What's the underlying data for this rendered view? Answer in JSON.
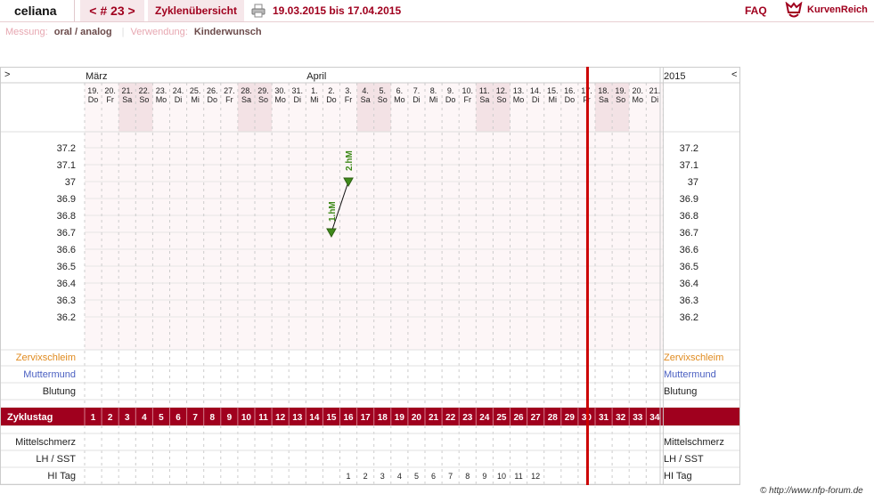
{
  "header": {
    "username": "celiana",
    "cycle_label": "< # 23 >",
    "overview_label": "Zyklenübersicht",
    "date_range": "19.03.2015 bis 17.04.2015",
    "faq_label": "FAQ",
    "brand": "KurvenReich"
  },
  "subbar": {
    "measurement_label": "Messung:",
    "measurement_value": "oral / analog",
    "usage_label": "Verwendung:",
    "usage_value": "Kinderwunsch"
  },
  "chart": {
    "nav_prev": ">",
    "nav_next": "<",
    "year": "2015",
    "months": [
      {
        "label": "März",
        "col": 0
      },
      {
        "label": "April",
        "col": 13
      }
    ],
    "days": [
      {
        "d": "19.",
        "w": "Do"
      },
      {
        "d": "20.",
        "w": "Fr"
      },
      {
        "d": "21.",
        "w": "Sa"
      },
      {
        "d": "22.",
        "w": "So"
      },
      {
        "d": "23.",
        "w": "Mo"
      },
      {
        "d": "24.",
        "w": "Di"
      },
      {
        "d": "25.",
        "w": "Mi"
      },
      {
        "d": "26.",
        "w": "Do"
      },
      {
        "d": "27.",
        "w": "Fr"
      },
      {
        "d": "28.",
        "w": "Sa"
      },
      {
        "d": "29.",
        "w": "So"
      },
      {
        "d": "30.",
        "w": "Mo"
      },
      {
        "d": "31.",
        "w": "Di"
      },
      {
        "d": "1.",
        "w": "Mi"
      },
      {
        "d": "2.",
        "w": "Do"
      },
      {
        "d": "3.",
        "w": "Fr"
      },
      {
        "d": "4.",
        "w": "Sa"
      },
      {
        "d": "5.",
        "w": "So"
      },
      {
        "d": "6.",
        "w": "Mo"
      },
      {
        "d": "7.",
        "w": "Di"
      },
      {
        "d": "8.",
        "w": "Mi"
      },
      {
        "d": "9.",
        "w": "Do"
      },
      {
        "d": "10.",
        "w": "Fr"
      },
      {
        "d": "11.",
        "w": "Sa"
      },
      {
        "d": "12.",
        "w": "So"
      },
      {
        "d": "13.",
        "w": "Mo"
      },
      {
        "d": "14.",
        "w": "Di"
      },
      {
        "d": "15.",
        "w": "Mi"
      },
      {
        "d": "16.",
        "w": "Do"
      },
      {
        "d": "17.",
        "w": "Fr"
      },
      {
        "d": "18.",
        "w": "Sa"
      },
      {
        "d": "19.",
        "w": "So"
      },
      {
        "d": "20.",
        "w": "Mo"
      },
      {
        "d": "21.",
        "w": "Di"
      }
    ],
    "temperature_ticks": [
      "37.2",
      "37.1",
      "37",
      "36.9",
      "36.8",
      "36.7",
      "36.6",
      "36.5",
      "36.4",
      "36.3",
      "36.2"
    ],
    "rows": {
      "cervical": "Zervixschleim",
      "cervix": "Muttermund",
      "bleeding": "Blutung",
      "cycle_day": "Zyklustag",
      "midpain": "Mittelschmerz",
      "lh": "LH / SST",
      "hi": "HI Tag"
    },
    "cycle_days": [
      "1",
      "2",
      "3",
      "4",
      "5",
      "6",
      "7",
      "8",
      "9",
      "10",
      "11",
      "12",
      "13",
      "14",
      "15",
      "16",
      "17",
      "18",
      "19",
      "20",
      "21",
      "22",
      "23",
      "24",
      "25",
      "26",
      "27",
      "28",
      "29",
      "30",
      "31",
      "32",
      "33",
      "34"
    ],
    "hi_days": [
      {
        "col": 15,
        "v": "1"
      },
      {
        "col": 16,
        "v": "2"
      },
      {
        "col": 17,
        "v": "3"
      },
      {
        "col": 18,
        "v": "4"
      },
      {
        "col": 19,
        "v": "5"
      },
      {
        "col": 20,
        "v": "6"
      },
      {
        "col": 21,
        "v": "7"
      },
      {
        "col": 22,
        "v": "8"
      },
      {
        "col": 23,
        "v": "9"
      },
      {
        "col": 24,
        "v": "10"
      },
      {
        "col": 25,
        "v": "11"
      },
      {
        "col": 26,
        "v": "12"
      }
    ],
    "today_col": 29,
    "colors": {
      "accent": "#a0001e",
      "today": "#cc0000",
      "weekend": "#f3e2e5",
      "point": "#3f8a1a",
      "cervical": "#e08a1e",
      "cervix": "#4a5fc1"
    }
  },
  "chart_data": {
    "type": "line",
    "ylim": [
      36.1,
      37.3
    ],
    "series": [
      {
        "name": "",
        "points": [
          {
            "day": "2.",
            "col": 14,
            "value": 36.7,
            "label": "1.hM"
          },
          {
            "day": "3.",
            "col": 15,
            "value": 37.0,
            "label": "2.hM"
          }
        ]
      }
    ]
  },
  "footer": {
    "copyright": "© http://www.nfp-forum.de"
  }
}
